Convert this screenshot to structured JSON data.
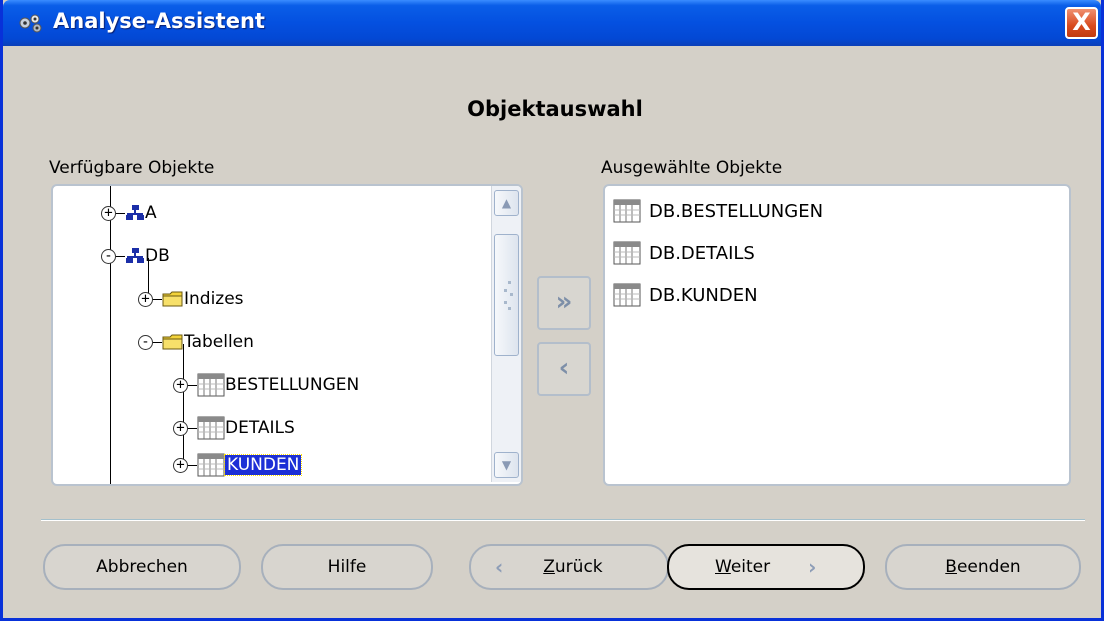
{
  "window": {
    "title": "Analyse-Assistent",
    "close_symbol": "X"
  },
  "heading": "Objektauswahl",
  "available": {
    "label": "Verfügbare Objekte",
    "tree": [
      {
        "label": "A",
        "icon": "schema-icon",
        "expander": "+"
      },
      {
        "label": "DB",
        "icon": "schema-icon",
        "expander": "-"
      },
      {
        "label": "Indizes",
        "icon": "folder-icon",
        "expander": "+"
      },
      {
        "label": "Tabellen",
        "icon": "folder-icon",
        "expander": "-"
      },
      {
        "label": "BESTELLUNGEN",
        "icon": "table-icon",
        "expander": "+"
      },
      {
        "label": "DETAILS",
        "icon": "table-icon",
        "expander": "+"
      },
      {
        "label": "KUNDEN",
        "icon": "table-icon",
        "expander": "+",
        "selected": true
      }
    ]
  },
  "move": {
    "add_symbol": "»",
    "remove_symbol": "‹"
  },
  "selected": {
    "label": "Ausgewählte Objekte",
    "items": [
      {
        "label": "DB.BESTELLUNGEN",
        "icon": "table-icon"
      },
      {
        "label": "DB.DETAILS",
        "icon": "table-icon"
      },
      {
        "label": "DB.KUNDEN",
        "icon": "table-icon"
      }
    ]
  },
  "buttons": {
    "cancel": "Abbrechen",
    "help": "Hilfe",
    "back_underline": "Z",
    "back_rest": "urück",
    "next_underline": "W",
    "next_rest": "eiter",
    "finish_underline": "B",
    "finish_rest": "eenden",
    "back_chevron": "‹",
    "next_chevron": "›"
  },
  "colors": {
    "titlebar": "#0450e0",
    "selection": "#1c2fd6",
    "dialog_bg": "#d4d0c8"
  }
}
